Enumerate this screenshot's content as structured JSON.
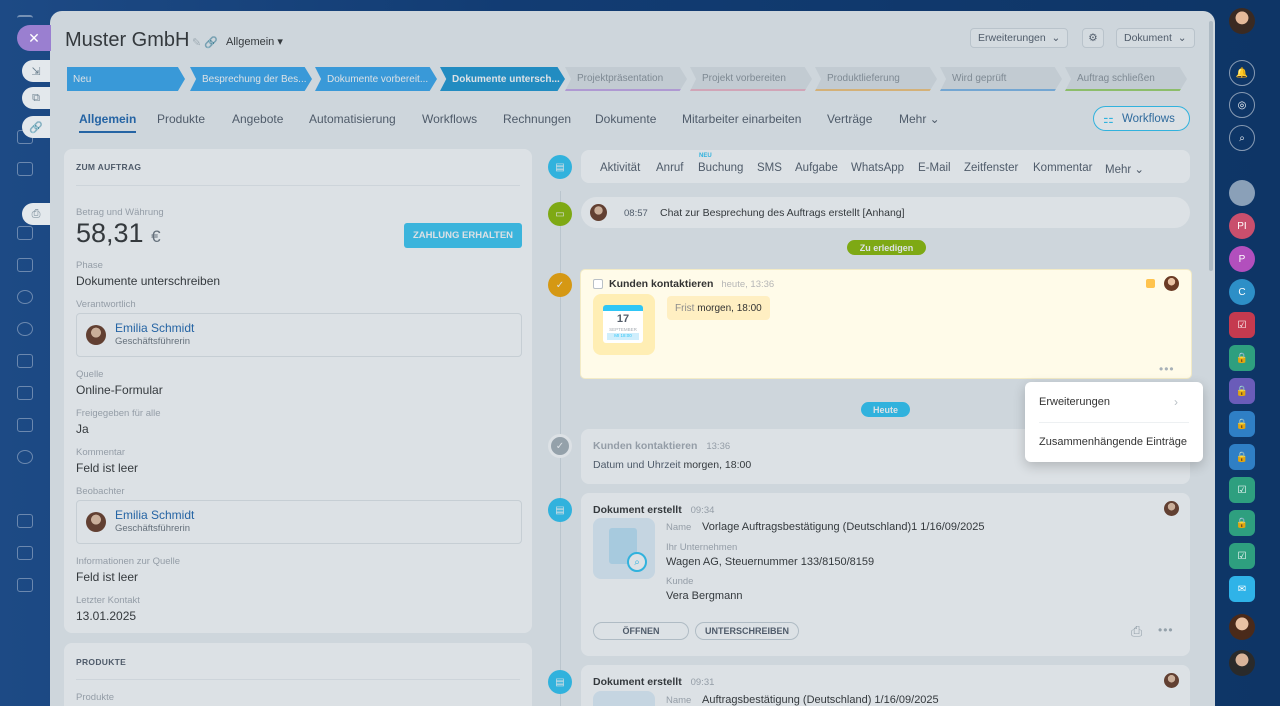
{
  "header": {
    "title": "Muster GmbH",
    "category": "Allgemein",
    "extensions_button": "Erweiterungen",
    "document_button": "Dokument"
  },
  "stages": [
    {
      "label": "Neu",
      "color": "#39a8ef"
    },
    {
      "label": "Besprechung der Bes...",
      "color": "#39a8ef"
    },
    {
      "label": "Dokumente vorbereit...",
      "color": "#39a8ef"
    },
    {
      "label": "Dokumente untersch...",
      "color": "#1d98d4"
    },
    {
      "label": "Projektpräsentation",
      "color": "#e0e4e8"
    },
    {
      "label": "Projekt vorbereiten",
      "color": "#e0e4e8"
    },
    {
      "label": "Produktlieferung",
      "color": "#e0e4e8"
    },
    {
      "label": "Wird geprüft",
      "color": "#e0e4e8"
    },
    {
      "label": "Auftrag schließen",
      "color": "#e0e4e8"
    }
  ],
  "tabs": [
    "Allgemein",
    "Produkte",
    "Angebote",
    "Automatisierung",
    "Workflows",
    "Rechnungen",
    "Dokumente",
    "Mitarbeiter einarbeiten",
    "Verträge",
    "Mehr"
  ],
  "workflows_button": "Workflows",
  "order": {
    "section_title": "ZUM AUFTRAG",
    "amount_label": "Betrag und Währung",
    "amount": "58,31",
    "currency": "€",
    "pay_button": "ZAHLUNG ERHALTEN",
    "phase_label": "Phase",
    "phase": "Dokumente unterschreiben",
    "responsible_label": "Verantwortlich",
    "responsible_name": "Emilia Schmidt",
    "responsible_role": "Geschäftsführerin",
    "source_label": "Quelle",
    "source": "Online-Formular",
    "shared_label": "Freigegeben für alle",
    "shared": "Ja",
    "comment_label": "Kommentar",
    "comment": "Feld ist leer",
    "observer_label": "Beobachter",
    "observer_name": "Emilia Schmidt",
    "observer_role": "Geschäftsführerin",
    "source_info_label": "Informationen zur Quelle",
    "source_info": "Feld ist leer",
    "last_contact_label": "Letzter Kontakt",
    "last_contact": "13.01.2025"
  },
  "products": {
    "section_title": "PRODUKTE",
    "products_label": "Produkte"
  },
  "activity_menu": {
    "new_badge": "NEU",
    "items": [
      "Aktivität",
      "Anruf",
      "Buchung",
      "SMS",
      "Aufgabe",
      "WhatsApp",
      "E-Mail",
      "Zeitfenster",
      "Kommentar",
      "Mehr"
    ]
  },
  "timeline": {
    "chat_time": "08:57",
    "chat_text": "Chat zur Besprechung des Auftrags erstellt [Anhang]",
    "todo_pill": "Zu erledigen",
    "todo_title": "Kunden kontaktieren",
    "todo_time": "heute, 13:36",
    "cal_day": "17",
    "cal_month": "SEPTEMBER",
    "cal_sub": "MI 18:00",
    "deadline_label": "Frist",
    "deadline_value": "morgen, 18:00",
    "today_pill": "Heute",
    "done_title": "Kunden kontaktieren",
    "done_time": "13:36",
    "done_detail_label": "Datum und Uhrzeit",
    "done_detail_value": "morgen, 18:00",
    "doc1_title": "Dokument erstellt",
    "doc1_time": "09:34",
    "doc1_name_label": "Name",
    "doc1_name": "Vorlage Auftragsbestätigung (Deutschland)1 1/16/09/2025",
    "doc1_company_label": "Ihr Unternehmen",
    "doc1_company": "Wagen AG, Steuernummer 133/8150/8159",
    "doc1_client_label": "Kunde",
    "doc1_client": "Vera Bergmann",
    "open_button": "ÖFFNEN",
    "sign_button": "UNTERSCHREIBEN",
    "doc2_title": "Dokument erstellt",
    "doc2_time": "09:31",
    "doc2_name_label": "Name",
    "doc2_name": "Auftragsbestätigung (Deutschland) 1/16/09/2025"
  },
  "dropdown": {
    "items": [
      "Erweiterungen",
      "Zusammenhängende Einträge"
    ]
  },
  "right_rail": {
    "avatar_initials": [
      "PI",
      "P",
      "C"
    ]
  }
}
